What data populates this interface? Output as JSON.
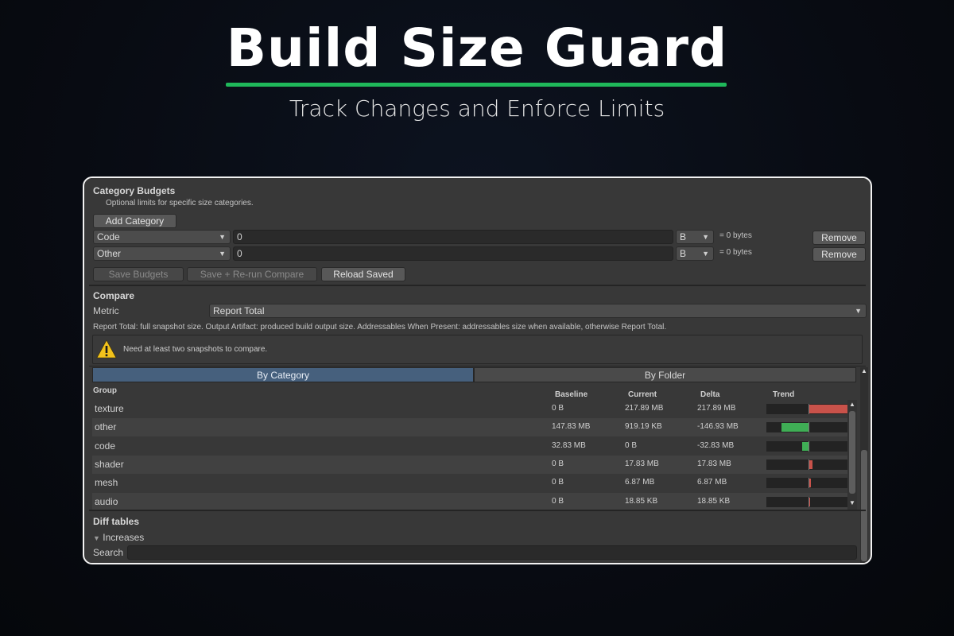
{
  "hero": {
    "title": "Build Size Guard",
    "subtitle": "Track Changes and Enforce Limits",
    "accent": "#1fb85a"
  },
  "budgets": {
    "title": "Category Budgets",
    "description": "Optional limits for specific size categories.",
    "add_label": "Add Category",
    "rows": [
      {
        "category": "Code",
        "value": "0",
        "unit": "B",
        "equals": "= 0 bytes",
        "remove_label": "Remove"
      },
      {
        "category": "Other",
        "value": "0",
        "unit": "B",
        "equals": "= 0 bytes",
        "remove_label": "Remove"
      }
    ],
    "save_label": "Save Budgets",
    "save_rerun_label": "Save + Re-run Compare",
    "reload_label": "Reload Saved"
  },
  "compare": {
    "title": "Compare",
    "metric_label": "Metric",
    "metric_value": "Report Total",
    "metric_help": "Report Total: full snapshot size. Output Artifact: produced build output size. Addressables When Present: addressables size when available, otherwise Report Total.",
    "warning": "Need at least two snapshots to compare.",
    "warning_icon": "warning-triangle-icon"
  },
  "tabs": [
    {
      "label": "By Category",
      "active": true
    },
    {
      "label": "By Folder",
      "active": false
    }
  ],
  "table": {
    "columns": {
      "group": "Group",
      "baseline": "Baseline",
      "current": "Current",
      "delta": "Delta",
      "trend": "Trend"
    },
    "rows": [
      {
        "group": "texture",
        "baseline": "0 B",
        "current": "217.89 MB",
        "delta": "217.89 MB",
        "trend": 1.0
      },
      {
        "group": "other",
        "baseline": "147.83 MB",
        "current": "919.19 KB",
        "delta": "-146.93 MB",
        "trend": -0.674
      },
      {
        "group": "code",
        "baseline": "32.83 MB",
        "current": "0 B",
        "delta": "-32.83 MB",
        "trend": -0.151
      },
      {
        "group": "shader",
        "baseline": "0 B",
        "current": "17.83 MB",
        "delta": "17.83 MB",
        "trend": 0.082
      },
      {
        "group": "mesh",
        "baseline": "0 B",
        "current": "6.87 MB",
        "delta": "6.87 MB",
        "trend": 0.032
      },
      {
        "group": "audio",
        "baseline": "0 B",
        "current": "18.85 KB",
        "delta": "18.85 KB",
        "trend": 0.0001
      }
    ],
    "increase_color": "#c9524a",
    "decrease_color": "#3fae55"
  },
  "diff": {
    "title": "Diff tables",
    "increases_label": "Increases",
    "search_label": "Search",
    "search_value": ""
  }
}
